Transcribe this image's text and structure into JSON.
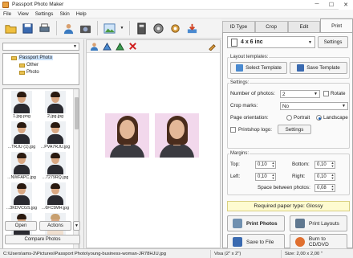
{
  "window": {
    "title": "Passport Photo Maker"
  },
  "menu": [
    "File",
    "View",
    "Settings",
    "Skin",
    "Help"
  ],
  "toolbar": {
    "buttons": [
      "open-folder-icon",
      "save-icon",
      "print-icon",
      "user-icon",
      "camera-icon",
      "image-icon",
      "dropdown-arrow-icon",
      "book-icon",
      "film-icon",
      "gear-icon",
      "download-icon"
    ]
  },
  "left": {
    "drive": "",
    "tree": {
      "root": "Passport Photo",
      "children": [
        "Other",
        "Photo"
      ]
    },
    "thumbnails": [
      {
        "caption": "1.jpg.png"
      },
      {
        "caption": "2.jpg.jpg"
      },
      {
        "caption": "...TRJU (1).jpg"
      },
      {
        "caption": "...PVA7RJU.jpg"
      },
      {
        "caption": "...NWFAPC.jpg"
      },
      {
        "caption": "...7279RQ.jpg"
      },
      {
        "caption": "...3KDVCGS.jpg"
      },
      {
        "caption": "...6FC5MH.jpg"
      },
      {
        "caption": ""
      },
      {
        "caption": ""
      }
    ],
    "open_label": "Open",
    "actions_label": "Actions",
    "compare_label": "Compare Photos"
  },
  "canvas_tools": [
    "person-left-icon",
    "rotate-left-icon",
    "rotate-right-icon",
    "delete-icon",
    "brush-icon"
  ],
  "tabs": [
    "ID Type",
    "Crop",
    "Edit",
    "Print"
  ],
  "active_tab": "Print",
  "print": {
    "paper_size": "4 x 6 inc",
    "settings_btn": "Settings",
    "layout_templates_label": "Layout templates:",
    "select_template": "Select Template",
    "save_template": "Save Template",
    "settings_label": "Settings:",
    "number_of_photos_label": "Number of photos:",
    "number_of_photos": "2",
    "rotate_label": "Rotate",
    "crop_marks_label": "Crop marks:",
    "crop_marks": "No",
    "page_orientation_label": "Page orientation:",
    "portrait_label": "Portrait",
    "landscape_label": "Landscape",
    "orientation": "Landscape",
    "printshop_logo_label": "Printshop logo:",
    "logo_settings_btn": "Settings",
    "margins_label": "Margins:",
    "top_label": "Top:",
    "top": "0,10",
    "bottom_label": "Bottom:",
    "bottom": "0,10",
    "left_label": "Left:",
    "left": "0,10",
    "right_label": "Right:",
    "right": "0,10",
    "space_label": "Space between photos:",
    "space": "0,08",
    "required_paper": "Required paper type: Glossy",
    "print_photos": "Print Photos",
    "print_layouts": "Print Layouts",
    "save_to_file": "Save to File",
    "burn_to_cd": "Burn to CD/DVD"
  },
  "status": {
    "path": "C:\\Users\\ams-2\\Pictures\\Passport Photo\\young-business-woman-JR78HJU.jpg",
    "idtype": "Visa   (2\" x 2\")",
    "size": "Size: 2,00 x 2,00 \""
  },
  "colors": {
    "photo_bg": "#f2d8ec",
    "required_bg": "#fefbd0",
    "accent": "#1a5fb4"
  }
}
